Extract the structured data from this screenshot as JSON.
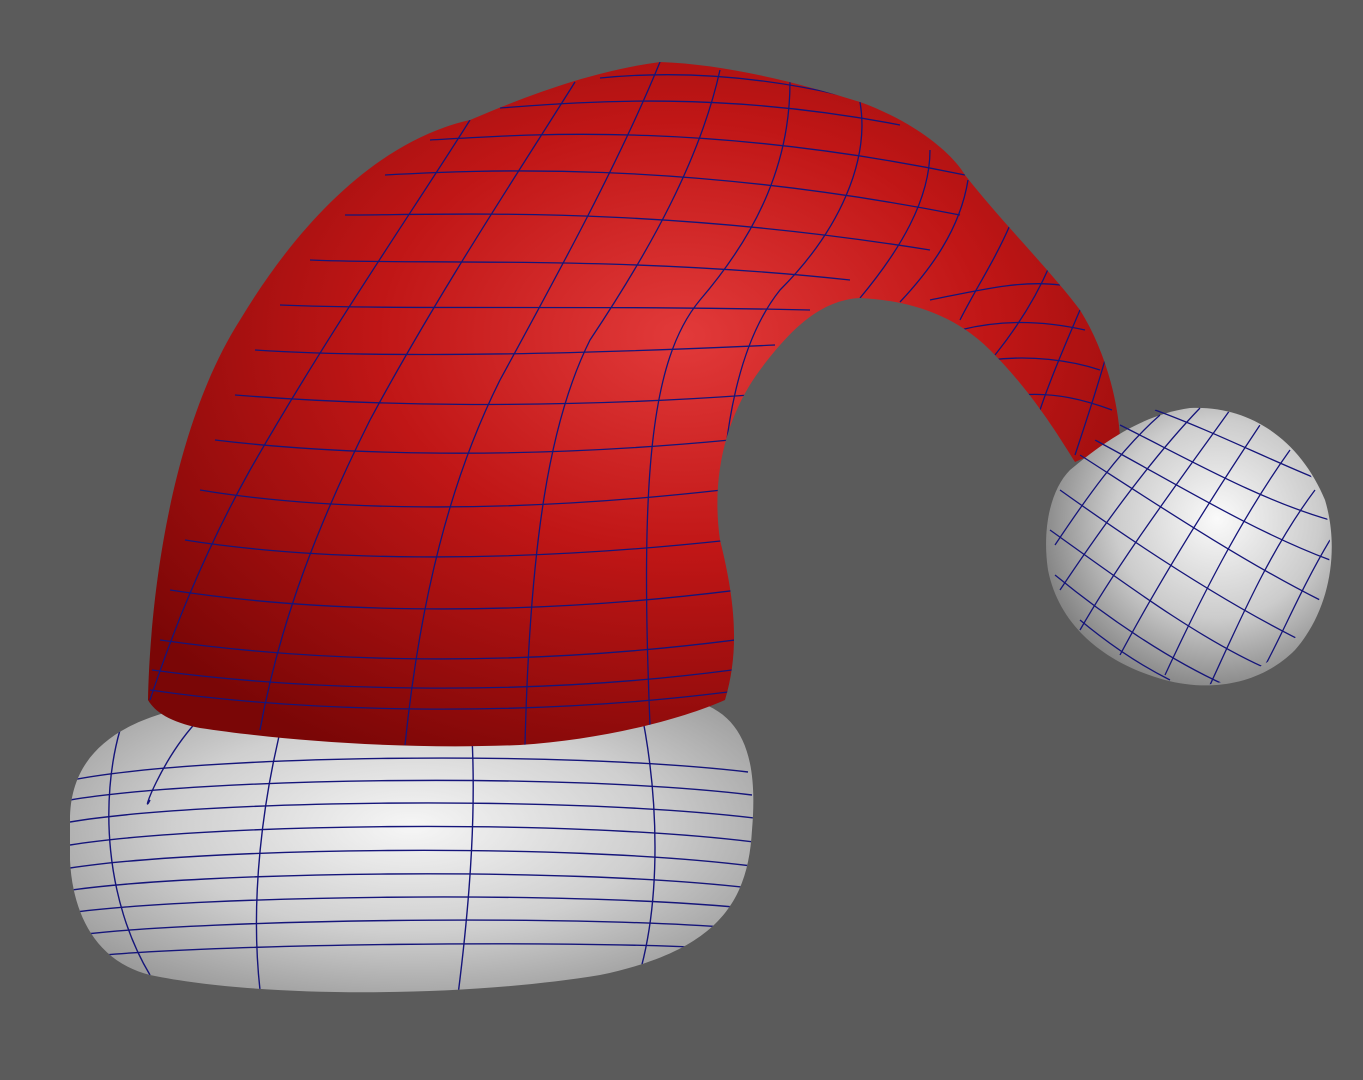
{
  "viewport": {
    "background_color": "#5b5b5b",
    "shading": "smooth-shaded-with-wireframe",
    "wireframe_color": "#15157a"
  },
  "model": {
    "subject": "santa-hat",
    "parts": [
      {
        "name": "hat-body",
        "color": "#b80f0f"
      },
      {
        "name": "fur-brim",
        "color": "#d2d2d2"
      },
      {
        "name": "pompom",
        "color": "#d2d2d2"
      }
    ]
  }
}
